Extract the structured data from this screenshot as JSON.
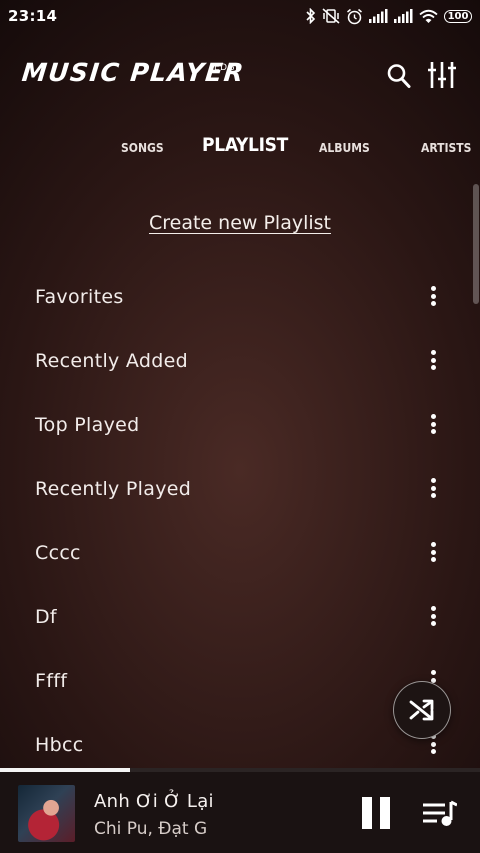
{
  "status": {
    "time": "23:14",
    "battery": "100"
  },
  "app": {
    "title": "MUSIC PLAYER",
    "badge": "EDGE"
  },
  "tabs": [
    {
      "label": "SONGS",
      "active": false
    },
    {
      "label": "PLAYLIST",
      "active": true
    },
    {
      "label": "ALBUMS",
      "active": false
    },
    {
      "label": "ARTISTS",
      "active": false
    }
  ],
  "create_playlist_label": "Create new Playlist",
  "playlists": [
    {
      "name": "Favorites"
    },
    {
      "name": "Recently Added"
    },
    {
      "name": "Top Played"
    },
    {
      "name": "Recently Played"
    },
    {
      "name": "Cccc"
    },
    {
      "name": "Df"
    },
    {
      "name": "Ffff"
    },
    {
      "name": "Hbcc"
    }
  ],
  "now_playing": {
    "title": "Anh Ơi Ở Lại",
    "artist": "Chi Pu, Đạt G",
    "progress": 0.27
  },
  "icons": {
    "search": "search-icon",
    "equalizer": "equalizer-icon",
    "more": "more-vert-icon",
    "shuffle": "shuffle-icon",
    "pause": "pause-icon",
    "queue": "queue-music-icon"
  }
}
